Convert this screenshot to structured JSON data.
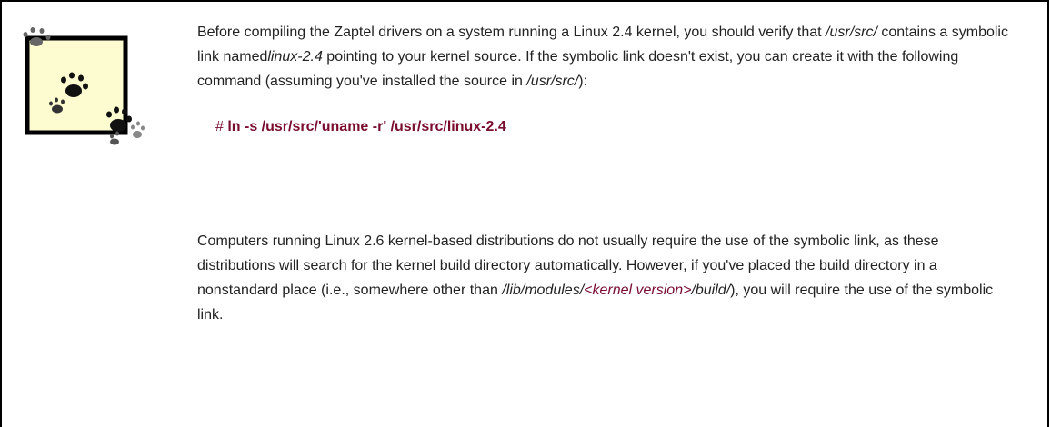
{
  "note": {
    "icon": "note-pawprint-icon",
    "para1": {
      "part1": "Before compiling  the Zaptel drivers on a system running a Linux 2.4 kernel, you should verify that ",
      "path1": "/usr/src/",
      "part2": " contains a symbolic link named",
      "path2": "linux-2.4",
      "part3": " pointing to your kernel source. If the symbolic link doesn't exist, you can create it with the following command (assuming you've installed the source in ",
      "path3": "/usr/src/",
      "part4": "):"
    },
    "command": {
      "prompt": "# ",
      "text": "ln -s /usr/src/'uname -r' /usr/src/linux-2.4"
    },
    "para2": {
      "part1": "Computers running Linux 2.6 kernel-based distributions do not usually require the use of the symbolic link, as these distributions will search for the kernel build directory automatically. However, if you've placed the build directory in a nonstandard place (i.e., somewhere other than ",
      "path_start": "/lib/modules/",
      "placeholder": "<kernel version>",
      "path_end": "/build/",
      "part2": "), you will require the use of the symbolic link."
    }
  },
  "colors": {
    "accent": "#7a0c2e",
    "icon_fill": "#fdfbd0",
    "border": "#000000"
  }
}
